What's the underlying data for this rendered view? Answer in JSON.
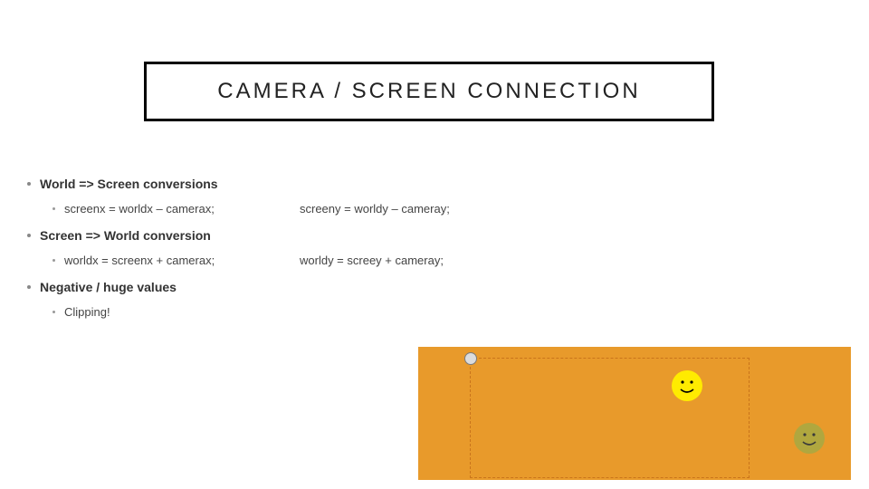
{
  "title": "CAMERA / SCREEN CONNECTION",
  "sections": [
    {
      "heading": "World => Screen conversions",
      "items": [
        {
          "left": "screenx = worldx – camerax;",
          "right": "screeny = worldy – cameray;"
        }
      ]
    },
    {
      "heading": "Screen => World conversion",
      "items": [
        {
          "left": "worldx = screenx + camerax;",
          "right": "worldy = screey + cameray;"
        }
      ]
    },
    {
      "heading": "Negative / huge values",
      "items": [
        {
          "left": "Clipping!",
          "right": ""
        }
      ]
    }
  ]
}
